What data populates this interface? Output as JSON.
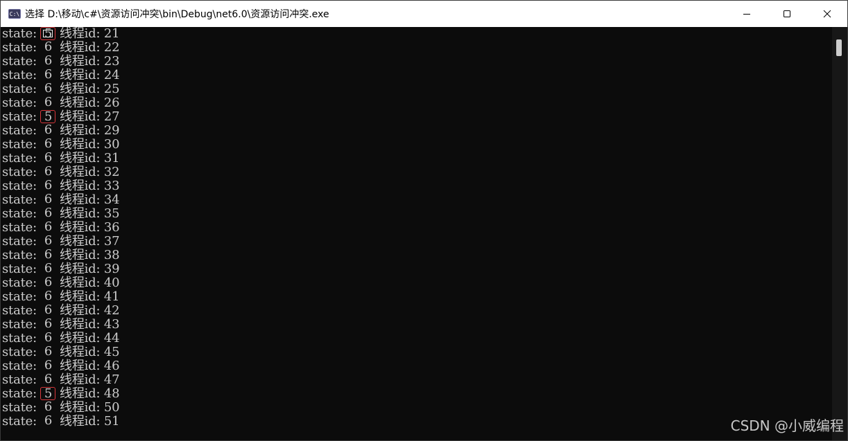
{
  "window": {
    "title": "选择 D:\\移动\\c#\\资源访问冲突\\bin\\Debug\\net6.0\\资源访问冲突.exe",
    "app_icon_text": "C:\\"
  },
  "console": {
    "label_state": "state: ",
    "label_thread": "线程id: ",
    "lines": [
      {
        "state": "5",
        "id": "21",
        "highlight": true,
        "cursor": true
      },
      {
        "state": "6",
        "id": "22",
        "highlight": false
      },
      {
        "state": "6",
        "id": "23",
        "highlight": false
      },
      {
        "state": "6",
        "id": "24",
        "highlight": false
      },
      {
        "state": "6",
        "id": "25",
        "highlight": false
      },
      {
        "state": "6",
        "id": "26",
        "highlight": false
      },
      {
        "state": "5",
        "id": "27",
        "highlight": true
      },
      {
        "state": "6",
        "id": "29",
        "highlight": false
      },
      {
        "state": "6",
        "id": "30",
        "highlight": false
      },
      {
        "state": "6",
        "id": "31",
        "highlight": false
      },
      {
        "state": "6",
        "id": "32",
        "highlight": false
      },
      {
        "state": "6",
        "id": "33",
        "highlight": false
      },
      {
        "state": "6",
        "id": "34",
        "highlight": false
      },
      {
        "state": "6",
        "id": "35",
        "highlight": false
      },
      {
        "state": "6",
        "id": "36",
        "highlight": false
      },
      {
        "state": "6",
        "id": "37",
        "highlight": false
      },
      {
        "state": "6",
        "id": "38",
        "highlight": false
      },
      {
        "state": "6",
        "id": "39",
        "highlight": false
      },
      {
        "state": "6",
        "id": "40",
        "highlight": false
      },
      {
        "state": "6",
        "id": "41",
        "highlight": false
      },
      {
        "state": "6",
        "id": "42",
        "highlight": false
      },
      {
        "state": "6",
        "id": "43",
        "highlight": false
      },
      {
        "state": "6",
        "id": "44",
        "highlight": false
      },
      {
        "state": "6",
        "id": "45",
        "highlight": false
      },
      {
        "state": "6",
        "id": "46",
        "highlight": false
      },
      {
        "state": "6",
        "id": "47",
        "highlight": false
      },
      {
        "state": "5",
        "id": "48",
        "highlight": true
      },
      {
        "state": "6",
        "id": "50",
        "highlight": false
      },
      {
        "state": "6",
        "id": "51",
        "highlight": false
      }
    ]
  },
  "watermark": "CSDN @小威编程",
  "icons": {
    "minimize": "minimize-icon",
    "maximize": "maximize-icon",
    "close": "close-icon"
  },
  "colors": {
    "background": "#0c0c0c",
    "text": "#cccccc",
    "highlight_border": "#d9383c",
    "titlebar": "#ffffff"
  }
}
